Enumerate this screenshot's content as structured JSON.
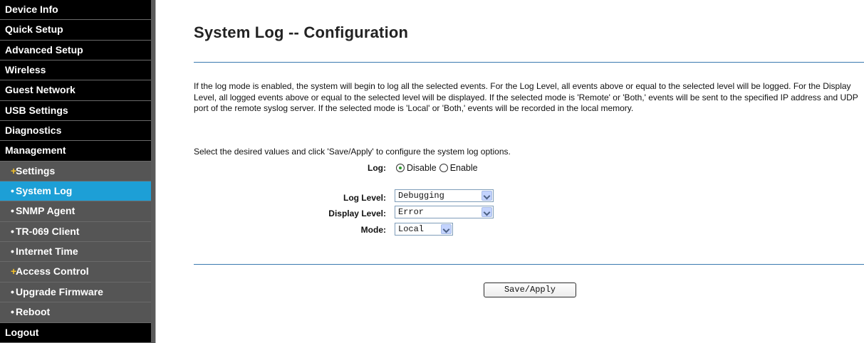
{
  "sidebar": {
    "items": [
      {
        "label": "Device Info",
        "kind": "top",
        "bullet": ""
      },
      {
        "label": "Quick Setup",
        "kind": "top",
        "bullet": ""
      },
      {
        "label": "Advanced Setup",
        "kind": "top",
        "bullet": ""
      },
      {
        "label": "Wireless",
        "kind": "top",
        "bullet": ""
      },
      {
        "label": "Guest Network",
        "kind": "top",
        "bullet": ""
      },
      {
        "label": "USB Settings",
        "kind": "top",
        "bullet": ""
      },
      {
        "label": "Diagnostics",
        "kind": "top",
        "bullet": ""
      },
      {
        "label": "Management",
        "kind": "top",
        "bullet": ""
      },
      {
        "label": "Settings",
        "kind": "sub",
        "bullet": "+"
      },
      {
        "label": "System Log",
        "kind": "sub",
        "bullet": "•",
        "active": true
      },
      {
        "label": "SNMP Agent",
        "kind": "sub",
        "bullet": "•"
      },
      {
        "label": "TR-069 Client",
        "kind": "sub",
        "bullet": "•"
      },
      {
        "label": "Internet Time",
        "kind": "sub",
        "bullet": "•"
      },
      {
        "label": "Access Control",
        "kind": "sub",
        "bullet": "+"
      },
      {
        "label": "Upgrade Firmware",
        "kind": "sub",
        "bullet": "•"
      },
      {
        "label": "Reboot",
        "kind": "sub",
        "bullet": "•"
      },
      {
        "label": "Logout",
        "kind": "top",
        "bullet": ""
      }
    ]
  },
  "main": {
    "title": "System Log -- Configuration",
    "description": "If the log mode is enabled, the system will begin to log all the selected events. For the Log Level, all events above or equal to the selected level will be logged. For the Display Level, all logged events above or equal to the selected level will be displayed. If the selected mode is 'Remote' or 'Both,' events will be sent to the specified IP address and UDP port of the remote syslog server. If the selected mode is 'Local' or 'Both,' events will be recorded in the local memory.",
    "instruction": "Select the desired values and click 'Save/Apply' to configure the system log options.",
    "log": {
      "label": "Log:",
      "options": [
        {
          "label": "Disable",
          "checked": true
        },
        {
          "label": "Enable",
          "checked": false
        }
      ]
    },
    "log_level": {
      "label": "Log Level:",
      "value": "Debugging"
    },
    "display_level": {
      "label": "Display Level:",
      "value": "Error"
    },
    "mode": {
      "label": "Mode:",
      "value": "Local"
    },
    "save_label": "Save/Apply"
  },
  "colors": {
    "sidebar_bg": "#000000",
    "submenu_bg": "#555555",
    "active_bg": "#1d9fd6",
    "plus_bullet": "#f2c029",
    "divider": "#3a7ab0"
  }
}
